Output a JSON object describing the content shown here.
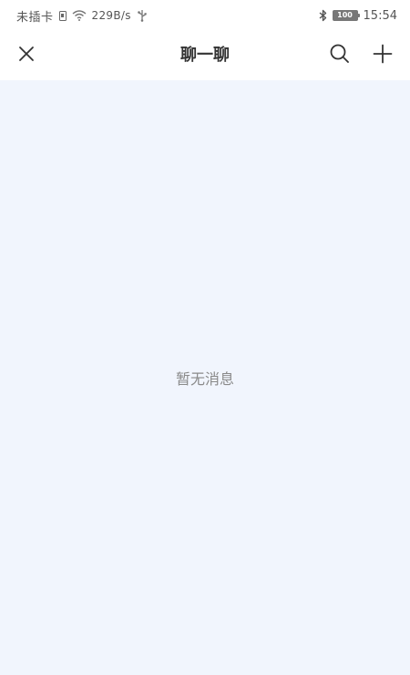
{
  "status_bar": {
    "carrier": "未插卡",
    "net_speed": "229B/s",
    "battery_level": "100",
    "time": "15:54",
    "icons": [
      "sim-icon",
      "wifi-icon",
      "usb-icon",
      "bluetooth-icon",
      "battery-icon"
    ]
  },
  "header": {
    "title": "聊一聊",
    "close_icon": "close-icon",
    "search_icon": "search-icon",
    "add_icon": "plus-icon"
  },
  "content": {
    "empty_message": "暂无消息"
  },
  "colors": {
    "header_background": "#ffffff",
    "content_background": "#f1f5fd",
    "title_text": "#333333",
    "empty_text": "#8a8a8a",
    "icon": "#333333"
  }
}
